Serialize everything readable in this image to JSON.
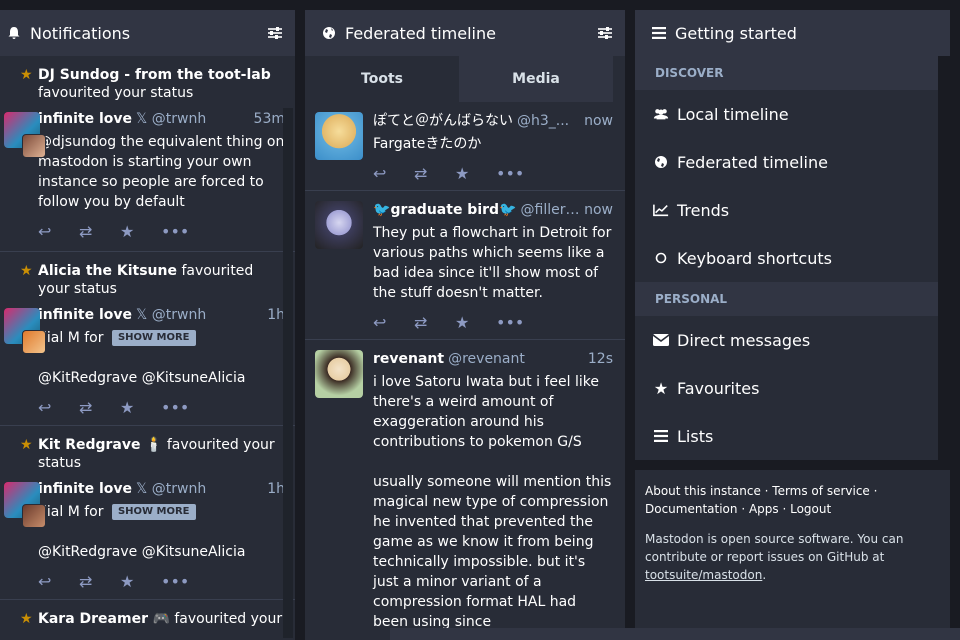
{
  "notifications_column": {
    "title": "Notifications",
    "header_icon": "bell-icon",
    "items": [
      {
        "actor": "DJ Sundog - from the toot-lab",
        "action": "favourited your status",
        "status": {
          "name": "infinite love",
          "platform_icon": "𝕏",
          "acct": "@trwnh",
          "time": "53m",
          "text": "@djsundog the equivalent thing on mastodon is starting your own instance so people are forced to follow you by default",
          "show_more": ""
        }
      },
      {
        "actor": "Alicia the Kitsune",
        "action": "favourited your status",
        "status": {
          "name": "infinite love",
          "platform_icon": "𝕏",
          "acct": "@trwnh",
          "time": "1h",
          "text_prefix": "dial M for",
          "show_more": "SHOW MORE",
          "mentions": "@KitRedgrave @KitsuneAlicia"
        }
      },
      {
        "actor": "Kit Redgrave",
        "actor_emoji": "🕯️",
        "action": "favourited your status",
        "status": {
          "name": "infinite love",
          "platform_icon": "𝕏",
          "acct": "@trwnh",
          "time": "1h",
          "text_prefix": "dial M for",
          "show_more": "SHOW MORE",
          "mentions": "@KitRedgrave @KitsuneAlicia"
        }
      },
      {
        "actor": "Kara Dreamer",
        "actor_emoji": "🎮",
        "action": "favourited your"
      }
    ]
  },
  "federated_column": {
    "title": "Federated timeline",
    "tabs": [
      "Toots",
      "Media"
    ],
    "toots": [
      {
        "name": "ぽてと＠がんばらない",
        "acct": "@h3_...",
        "time": "now",
        "text": "Fargateきたのか",
        "avatar_color": "#f3d27a"
      },
      {
        "name": "graduate bird",
        "name_prefix_emoji": "🐦",
        "name_suffix_emoji": "🐦",
        "acct": "@fillertra...",
        "time": "now",
        "text": "They put a flowchart in Detroit for various paths which seems like a bad idea since it'll show most of the stuff doesn't matter.",
        "avatar_color": "#4c4c6b"
      },
      {
        "name": "revenant",
        "acct": "@revenant",
        "time": "12s",
        "text": "i love Satoru Iwata but i feel like there's a weird amount of exaggeration around his contributions to pokemon G/S\n\nusually someone will mention this magical new type of compression he invented that prevented the game as we know it from being technically impossible. but it's just a minor variant of a compression format HAL had been using since",
        "avatar_color": "#b5cfa3"
      }
    ]
  },
  "getting_started": {
    "title": "Getting started",
    "sections": [
      {
        "label": "DISCOVER",
        "items": [
          {
            "label": "Local timeline",
            "icon": "users-icon"
          },
          {
            "label": "Federated timeline",
            "icon": "globe-icon"
          },
          {
            "label": "Trends",
            "icon": "chart-line-icon"
          },
          {
            "label": "Keyboard shortcuts",
            "icon": "circle-icon"
          }
        ]
      },
      {
        "label": "PERSONAL",
        "items": [
          {
            "label": "Direct messages",
            "icon": "envelope-icon"
          },
          {
            "label": "Favourites",
            "icon": "star-icon"
          },
          {
            "label": "Lists",
            "icon": "list-icon"
          }
        ]
      }
    ],
    "footer": {
      "links_line1": "About this instance · Terms of service ·",
      "links_line2": "Documentation · Apps · Logout",
      "about_text": "Mastodon is open source software. You can contribute or report issues on GitHub at",
      "repo_link": "tootsuite/mastodon"
    }
  },
  "colors": {
    "background": "#191b22",
    "column": "#282c37",
    "header": "#313543",
    "star": "#ca8f04",
    "muted": "#9baec8",
    "action": "#8d9ac2"
  }
}
